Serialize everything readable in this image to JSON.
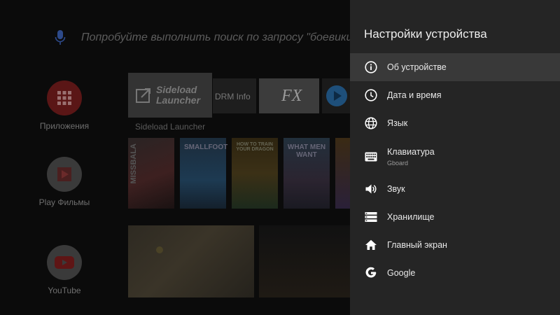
{
  "launcher": {
    "search_placeholder": "Попробуйте выполнить поиск по запросу \"боевики\"",
    "apps": [
      {
        "label": "Приложения",
        "icon": "apps-grid-icon",
        "color": "#b5292a"
      },
      {
        "label": "Play Фильмы",
        "icon": "play-movies-icon",
        "color": "#c0392b"
      },
      {
        "label": "YouTube",
        "icon": "youtube-icon",
        "color": "#d32f2f"
      }
    ],
    "favorites": {
      "sideload_tile_text": "Sideload Launcher",
      "sideload_caption": "Sideload Launcher",
      "drm_tile_text": "DRM Info",
      "fx_tile_text": "FX"
    },
    "posters": [
      "MISSBALA",
      "SMALLFOOT",
      "HOW TO TRAIN YOUR DRAGON",
      "WHAT MEN WANT",
      ""
    ]
  },
  "panel": {
    "title": "Настройки устройства",
    "items": [
      {
        "label": "Об устройстве",
        "icon": "info-icon",
        "selected": true
      },
      {
        "label": "Дата и время",
        "icon": "clock-icon"
      },
      {
        "label": "Язык",
        "icon": "globe-icon"
      },
      {
        "label": "Клавиатура",
        "sublabel": "Gboard",
        "icon": "keyboard-icon"
      },
      {
        "label": "Звук",
        "icon": "speaker-icon"
      },
      {
        "label": "Хранилище",
        "icon": "storage-icon"
      },
      {
        "label": "Главный экран",
        "icon": "home-icon"
      },
      {
        "label": "Google",
        "icon": "google-icon"
      }
    ]
  }
}
